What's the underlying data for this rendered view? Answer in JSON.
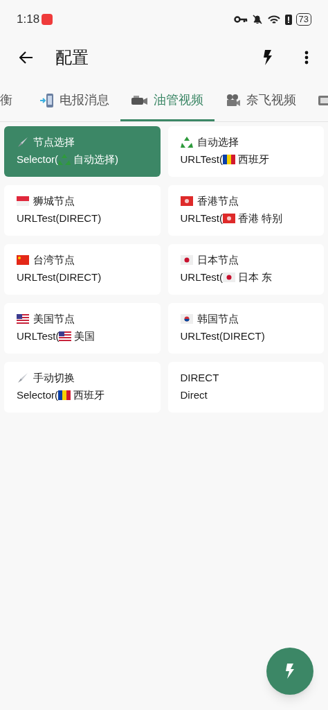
{
  "status_bar": {
    "time": "1:18",
    "battery": "73"
  },
  "app_bar": {
    "title": "配置"
  },
  "tabs": [
    {
      "label": "衡",
      "selected": false
    },
    {
      "label": "电报消息",
      "selected": false
    },
    {
      "label": "油管视频",
      "selected": true
    },
    {
      "label": "奈飞视频",
      "selected": false
    },
    {
      "selected": false
    }
  ],
  "groups": [
    {
      "title": "节点选择",
      "detail": "Selector(",
      "detail_after": "自动选择)",
      "selected": true
    },
    {
      "title": "自动选择",
      "detail": "URLTest(",
      "detail_after": "西班牙",
      "selected": false
    },
    {
      "title": "狮城节点",
      "detail": "URLTest(DIRECT)",
      "selected": false
    },
    {
      "title": "香港节点",
      "detail": "URLTest(",
      "detail_after": "香港 特别",
      "selected": false
    },
    {
      "title": "台湾节点",
      "detail": "URLTest(DIRECT)",
      "selected": false
    },
    {
      "title": "日本节点",
      "detail": "URLTest(",
      "detail_after": "日本 东",
      "selected": false
    },
    {
      "title": "美国节点",
      "detail": "URLTest(",
      "detail_after": "美国",
      "selected": false
    },
    {
      "title": "韩国节点",
      "detail": "URLTest(DIRECT)",
      "selected": false
    },
    {
      "title": "手动切换",
      "detail": "Selector(",
      "detail_after": "西班牙",
      "selected": false
    },
    {
      "title": "DIRECT",
      "detail": "Direct",
      "selected": false
    }
  ]
}
